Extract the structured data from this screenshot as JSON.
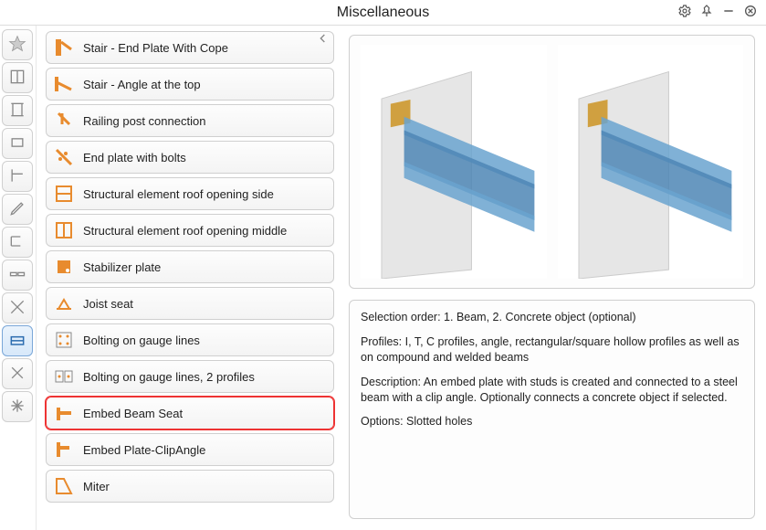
{
  "header": {
    "title": "Miscellaneous"
  },
  "sidebar": {
    "items": [
      {
        "name": "star"
      },
      {
        "name": "frame"
      },
      {
        "name": "beam"
      },
      {
        "name": "plate"
      },
      {
        "name": "bracket"
      },
      {
        "name": "pencil"
      },
      {
        "name": "channel"
      },
      {
        "name": "splice"
      },
      {
        "name": "brace"
      },
      {
        "name": "misc",
        "selected": true
      },
      {
        "name": "tools"
      },
      {
        "name": "other"
      }
    ]
  },
  "list": {
    "items": [
      {
        "label": "Stair - End Plate With Cope"
      },
      {
        "label": "Stair - Angle at the top"
      },
      {
        "label": "Railing post connection"
      },
      {
        "label": "End plate with bolts"
      },
      {
        "label": "Structural element roof opening side"
      },
      {
        "label": "Structural element roof opening middle"
      },
      {
        "label": "Stabilizer plate"
      },
      {
        "label": "Joist seat"
      },
      {
        "label": "Bolting on gauge lines"
      },
      {
        "label": "Bolting on gauge lines, 2 profiles"
      },
      {
        "label": "Embed Beam Seat",
        "selected": true
      },
      {
        "label": "Embed Plate-ClipAngle"
      },
      {
        "label": "Miter"
      }
    ]
  },
  "description": {
    "selection_label": "Selection order:",
    "selection_text": "1. Beam, 2. Concrete object (optional)",
    "profiles_label": "Profiles:",
    "profiles_text": "I, T, C profiles, angle,  rectangular/square hollow profiles as well as on compound and welded beams",
    "description_label": "Description:",
    "description_text": "An embed plate with studs is created and connected to a steel beam with a clip angle.  Optionally connects a concrete object if selected.",
    "options_label": "Options:",
    "options_text": "Slotted holes"
  }
}
